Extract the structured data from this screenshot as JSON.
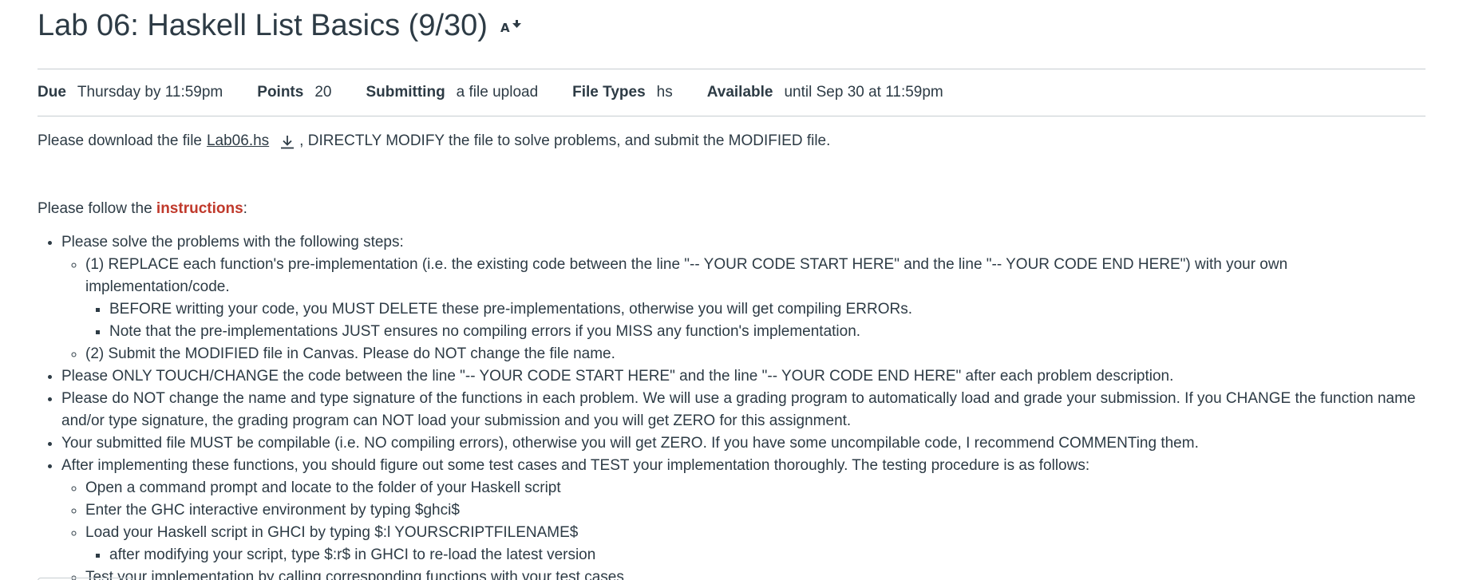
{
  "header": {
    "title": "Lab 06: Haskell List Basics (9/30)",
    "title_icon": "accessibility-reader-icon"
  },
  "details": [
    {
      "label": "Due",
      "value": "Thursday by 11:59pm"
    },
    {
      "label": "Points",
      "value": "20"
    },
    {
      "label": "Submitting",
      "value": "a file upload"
    },
    {
      "label": "File Types",
      "value": "hs"
    },
    {
      "label": "Available",
      "value": "until Sep 30 at 11:59pm"
    }
  ],
  "download": {
    "prefix": "Please download the file",
    "file_name": "Lab06.hs",
    "suffix": ", DIRECTLY MODIFY the file to solve problems, and submit the MODIFIED file."
  },
  "follow": {
    "prefix": "Please follow the ",
    "highlight": "instructions",
    "suffix": ":"
  },
  "instructions": {
    "item1": "Please solve the problems with the following steps:",
    "item1_sub1": "(1) REPLACE each function's pre-implementation (i.e. the existing code between the line \"-- YOUR CODE START HERE\" and the line \"-- YOUR CODE END HERE\") with your own implementation/code.",
    "item1_sub1_a": "BEFORE writting your code, you MUST DELETE these pre-implementations, otherwise you will get compiling ERRORs.",
    "item1_sub1_b": "Note that the pre-implementations JUST ensures no compiling errors if you MISS any function's implementation.",
    "item1_sub2": "(2) Submit the MODIFIED file in Canvas. Please do NOT change the file name.",
    "item2": "Please ONLY TOUCH/CHANGE the code between the line \"-- YOUR CODE START HERE\" and the line \"-- YOUR CODE END HERE\" after each problem description.",
    "item3": "Please do NOT change the name and type signature of the functions in each problem. We will use a grading program to automatically load and grade your submission. If you CHANGE the function name and/or type signature, the grading program can NOT load your submission and you will get ZERO for this assignment.",
    "item4": "Your submitted file MUST be compilable (i.e. NO compiling errors), otherwise you will get ZERO. If you have some uncompilable code, I recommend COMMENTing them.",
    "item5": "After implementing these functions, you should figure out some test cases and TEST your implementation thoroughly. The testing procedure is as follows:",
    "item5_sub1": "Open a command prompt and locate to the folder of your Haskell script",
    "item5_sub2": "Enter the GHC interactive environment by typing $ghci$",
    "item5_sub3": "Load your Haskell script in GHCI by typing $:l YOURSCRIPTFILENAME$",
    "item5_sub3_a": "after modifying your script, type $:r$ in GHCI to re-load the latest version",
    "item5_sub4": "Test your implementation by calling corresponding functions with your test cases"
  },
  "colors": {
    "text": "#2d3b45",
    "accent": "#c0392b",
    "divider": "#c7cdd1"
  }
}
